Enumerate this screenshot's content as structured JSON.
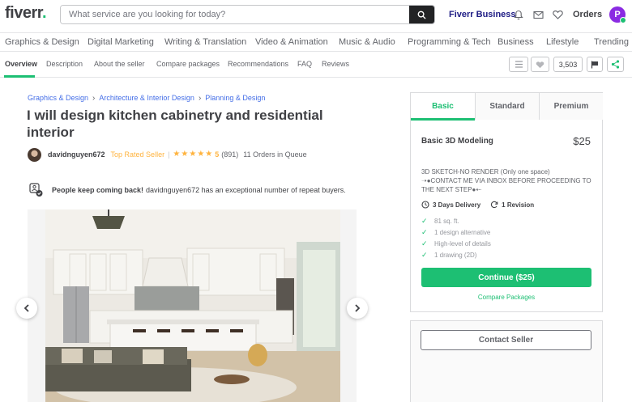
{
  "header": {
    "logo": "fiverr",
    "logo_dot": ".",
    "search_placeholder": "What service are you looking for today?",
    "fiverr_business": "Fiverr Business",
    "orders": "Orders",
    "avatar_initial": "P",
    "brand_color": "#1dbf73"
  },
  "categories": [
    "Graphics & Design",
    "Digital Marketing",
    "Writing & Translation",
    "Video & Animation",
    "Music & Audio",
    "Programming & Tech",
    "Business",
    "Lifestyle",
    "Trending"
  ],
  "subnav": {
    "tabs": [
      "Overview",
      "Description",
      "About the seller",
      "Compare packages",
      "Recommendations",
      "FAQ",
      "Reviews"
    ],
    "active_tab": "Overview",
    "like_count": "3,503"
  },
  "breadcrumb": [
    "Graphics & Design",
    "Architecture & Interior Design",
    "Planning & Design"
  ],
  "gig": {
    "title": "I will design kitchen cabinetry and residential interior",
    "seller_name": "davidnguyen672",
    "seller_level": "Top Rated Seller",
    "stars": "★★★★★",
    "rating": "5",
    "reviews": "(891)",
    "queue": "11 Orders in Queue",
    "repeat_bold": "People keep coming back!",
    "repeat_text": "davidnguyen672 has an exceptional number of repeat buyers."
  },
  "package": {
    "tabs": [
      "Basic",
      "Standard",
      "Premium"
    ],
    "active_tab": "Basic",
    "name": "Basic 3D Modeling",
    "price": "$25",
    "description": "3D SKETCH-NO RENDER (Only one space) ➝●CONTACT ME VIA INBOX BEFORE PROCEEDING TO THE NEXT STEP●⇠",
    "delivery": "3 Days Delivery",
    "revisions": "1 Revision",
    "features": [
      "81 sq. ft.",
      "1 design alternative",
      "High-level of details",
      "1 drawing (2D)"
    ],
    "continue": "Continue ($25)",
    "compare": "Compare Packages",
    "contact": "Contact Seller"
  }
}
